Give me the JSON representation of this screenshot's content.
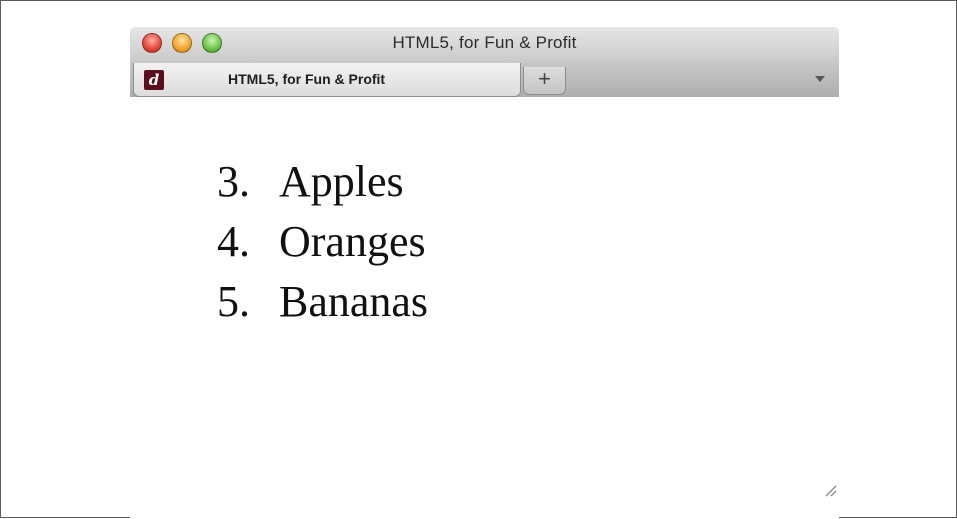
{
  "window": {
    "title": "HTML5, for Fun & Profit"
  },
  "tabs": [
    {
      "label": "HTML5, for Fun & Profit",
      "favicon": "dl-logo-icon"
    }
  ],
  "new_tab_label": "+",
  "content": {
    "list": [
      {
        "number": "3.",
        "text": "Apples"
      },
      {
        "number": "4.",
        "text": "Oranges"
      },
      {
        "number": "5.",
        "text": "Bananas"
      }
    ]
  },
  "colors": {
    "close": "#e2463a",
    "minimize": "#f0a52c",
    "zoom": "#6bc247",
    "favicon_bg": "#5a0e1e"
  },
  "icons": [
    "close-button",
    "minimize-button",
    "zoom-button",
    "favicon-icon",
    "new-tab-button",
    "tab-list-menu-icon",
    "resize-grip-icon"
  ]
}
